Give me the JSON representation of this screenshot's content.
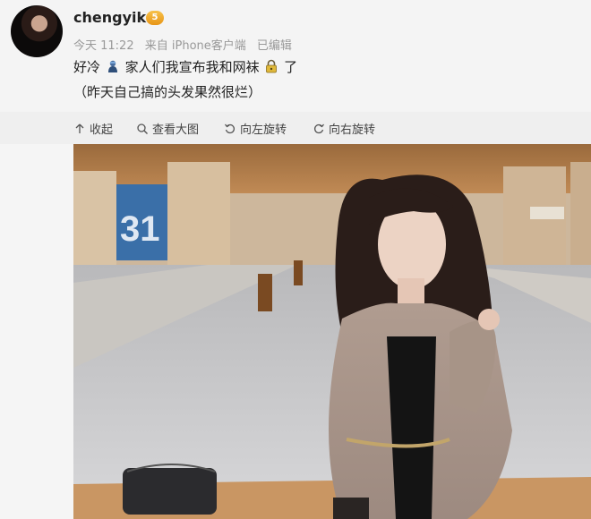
{
  "post": {
    "username": "chengyik",
    "vip_badge": "5",
    "time": "今天 11:22",
    "source": "来自 iPhone客户端",
    "edited": "已编辑",
    "text_part1": "好冷",
    "text_part2": "家人们我宣布我和网袜",
    "text_part3": "了",
    "note": "（昨天自己搞的头发果然很烂）"
  },
  "toolbar": {
    "collapse": "收起",
    "view_large": "查看大图",
    "rotate_left": "向左旋转",
    "rotate_right": "向右旋转"
  },
  "photo": {
    "sign_number": "31"
  },
  "colors": {
    "accent_badge": "#f0a42a",
    "background": "#f4f4f4"
  }
}
